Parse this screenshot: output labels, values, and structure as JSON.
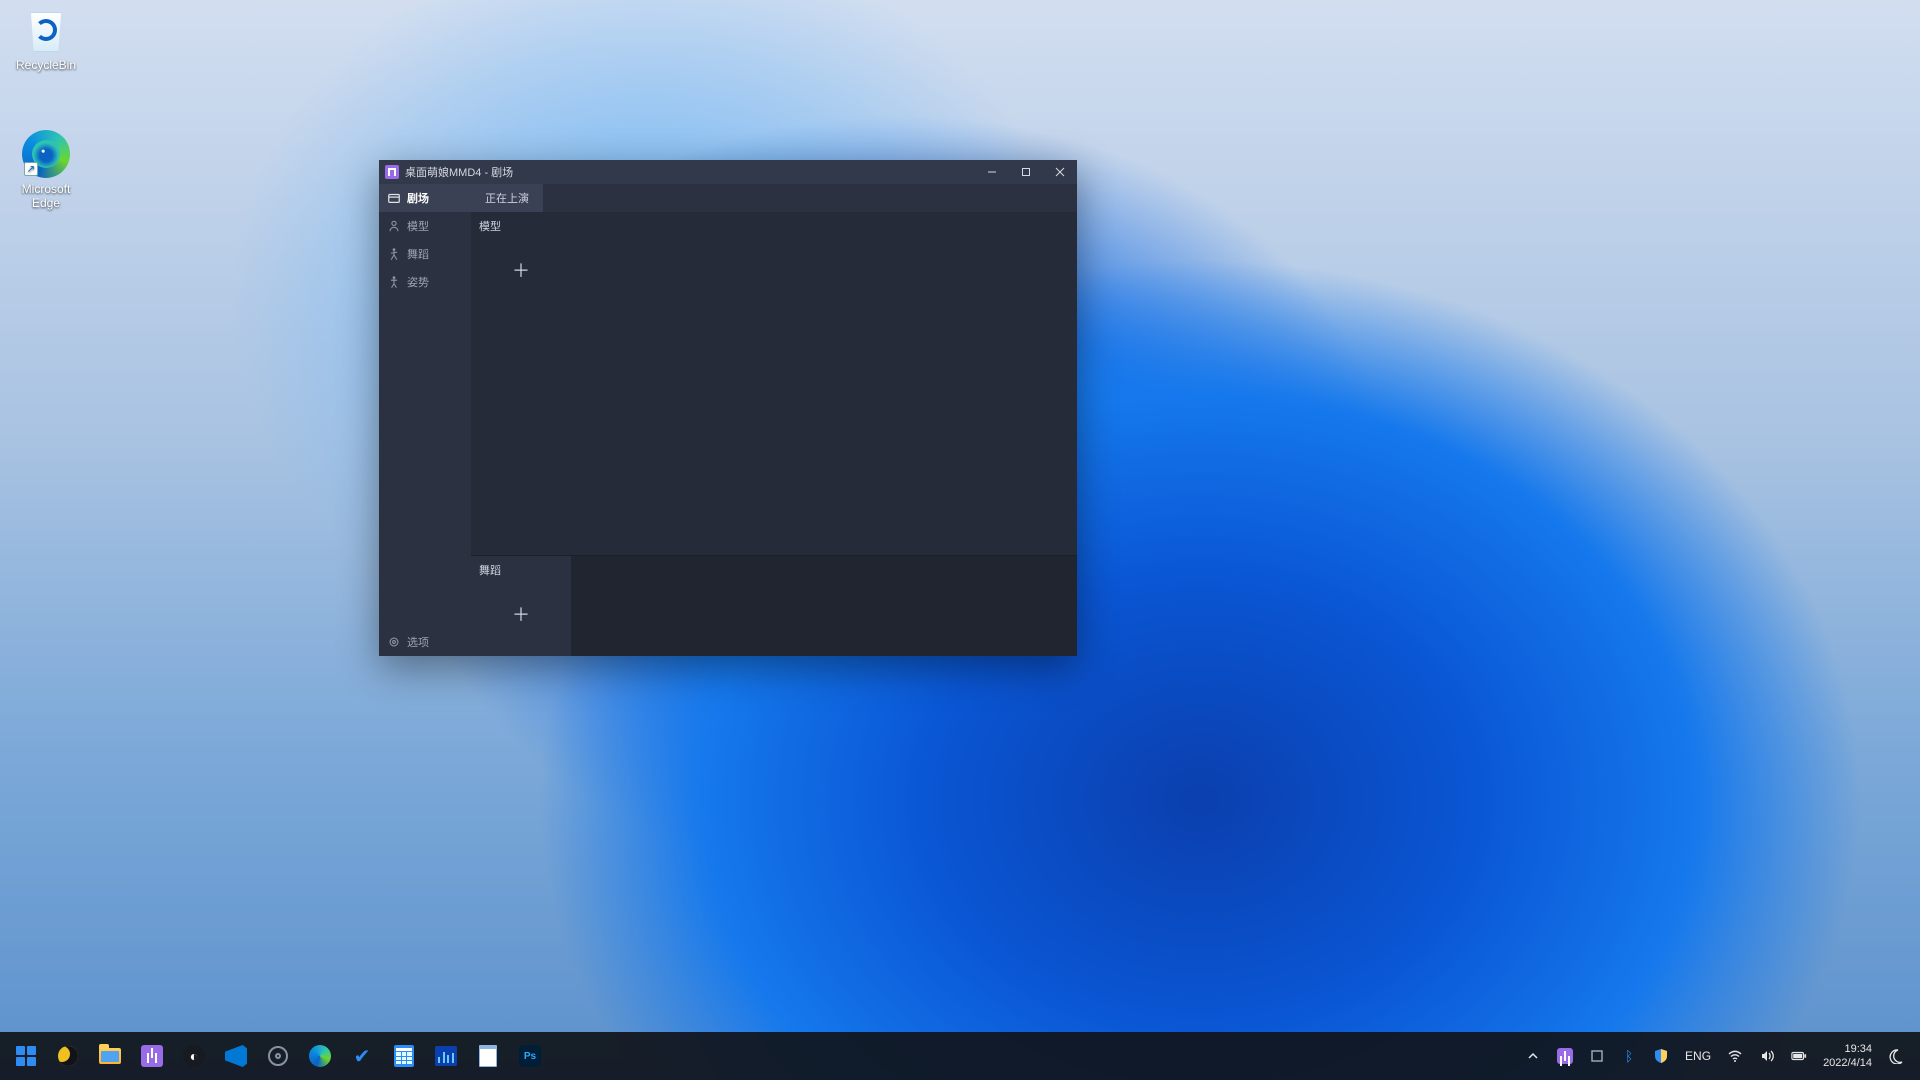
{
  "desktop": {
    "icons": {
      "recycle_bin": "RecycleBin",
      "edge": "Microsoft\nEdge"
    }
  },
  "app": {
    "title": "桌面萌娘MMD4 - 剧场",
    "sidebar": {
      "theater": "剧场",
      "model": "模型",
      "dance": "舞蹈",
      "pose": "姿势",
      "options": "选项"
    },
    "tab_now_playing": "正在上演",
    "section_model": "模型",
    "section_dance": "舞蹈"
  },
  "tray": {
    "language": "ENG"
  },
  "clock": {
    "time": "19:34",
    "date": "2022/4/14"
  }
}
